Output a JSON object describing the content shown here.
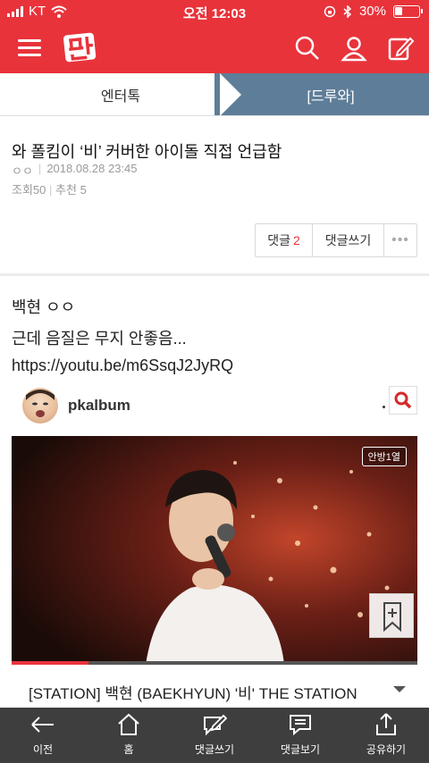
{
  "status_bar": {
    "carrier": "KT",
    "time": "오전 12:03",
    "battery_text": "30%",
    "battery_level": 0.3
  },
  "header": {
    "logo_text": "판",
    "icons": [
      "menu-icon",
      "search-icon",
      "user-icon",
      "edit-icon"
    ]
  },
  "breadcrumb": {
    "section": "엔터톡",
    "category": "[드루와]"
  },
  "post": {
    "title": "와 폴킴이 ‘비’ 커버한 아이돌 직접 언급함",
    "author": "ㅇㅇ",
    "date": "2018.08.28 23:45",
    "views_label": "조회",
    "views": "50",
    "recommend_label": "추천",
    "recommends": "5",
    "comment_label": "댓글",
    "comment_count": "2",
    "write_comment_label": "댓글쓰기",
    "more_label": "•••"
  },
  "body": {
    "lines": [
      "백현 ㅇㅇ",
      "근데 음질은 무지 안좋음...",
      "https://youtu.be/m6SsqJ2JyRQ"
    ]
  },
  "embed": {
    "channel": "pkalbum",
    "badge": "안방1열",
    "progress": 0.19,
    "video_title": "[STATION] 백현 (BAEKHYUN) '비' THE STATION"
  },
  "bottom_nav": {
    "items": [
      {
        "label": "이전",
        "icon": "arrow-left-icon"
      },
      {
        "label": "홈",
        "icon": "home-icon"
      },
      {
        "label": "댓글쓰기",
        "icon": "write-comment-icon"
      },
      {
        "label": "댓글보기",
        "icon": "view-comment-icon"
      },
      {
        "label": "공유하기",
        "icon": "share-icon"
      }
    ]
  },
  "colors": {
    "brand_red": "#e8333b",
    "category_blue": "#5e7d98",
    "nav_bg": "#3e3e3e"
  }
}
